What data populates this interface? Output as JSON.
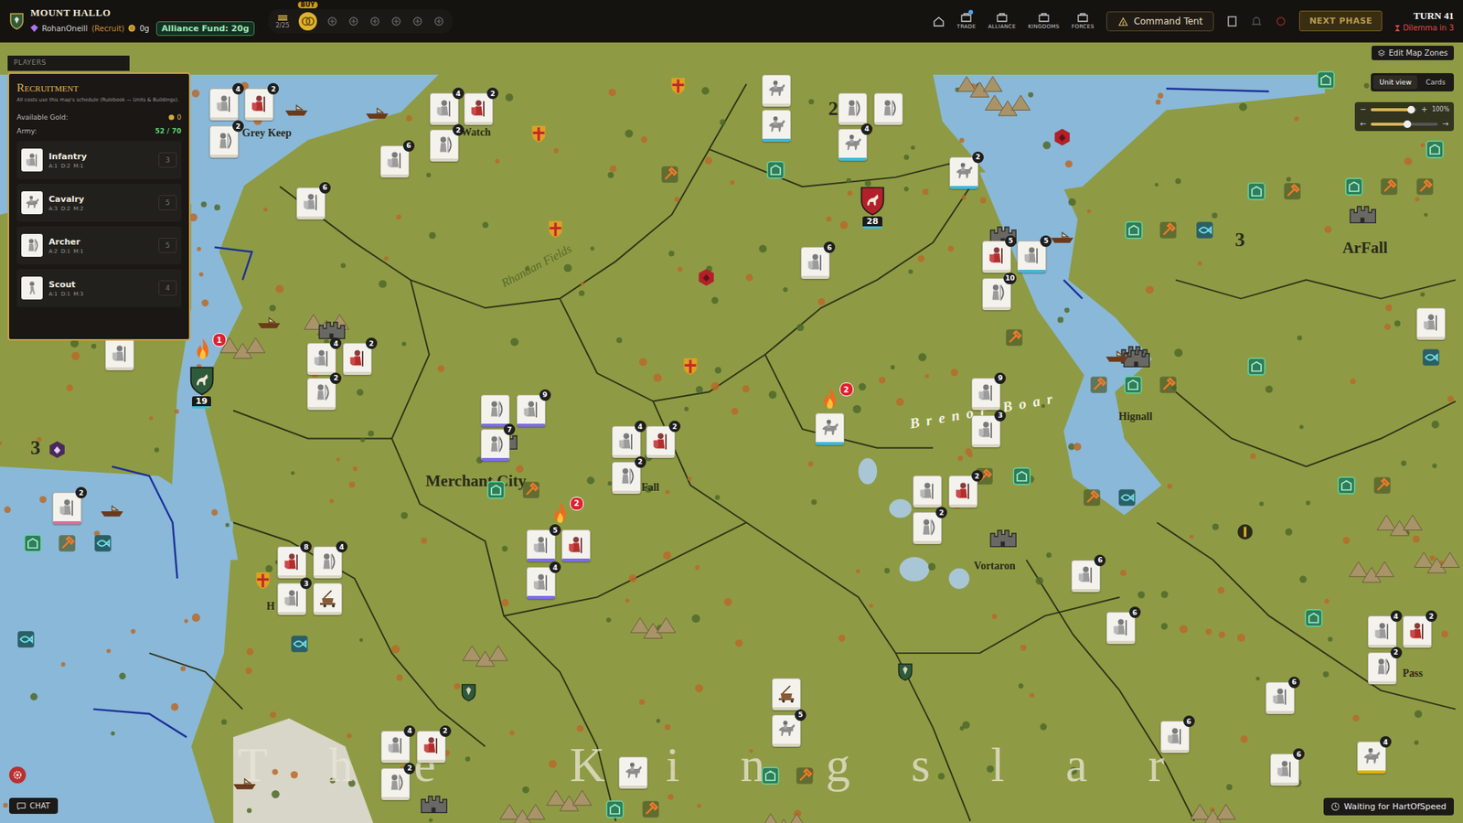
{
  "topbar": {
    "realm": "MOUNT HALLO",
    "player": "RohanOneill",
    "rank": "(Recruit)",
    "gold": "0g",
    "alliance_fund": "Alliance Fund: 20g",
    "supply": "2/25",
    "buy": "BUY",
    "nav": [
      {
        "label": "TRADE",
        "badge": true
      },
      {
        "label": "ALLIANCE",
        "badge": false
      },
      {
        "label": "KINGDOMS",
        "badge": false
      },
      {
        "label": "FORCES",
        "badge": false
      }
    ],
    "command_tent": "Command Tent",
    "next_phase": "NEXT PHASE",
    "turn": "TURN 41",
    "dilemma": "Dilemma in 3"
  },
  "edit_zones": "Edit Map Zones",
  "players_tab": "PLAYERS",
  "view_toggle": [
    {
      "label": "Unit view",
      "selected": true
    },
    {
      "label": "Cards",
      "selected": false
    }
  ],
  "zoom": {
    "reading": "100%",
    "level": 0.88,
    "minus": "−",
    "plus": "+"
  },
  "pan": {
    "level": 0.55,
    "left": "←",
    "right": "→"
  },
  "recruitment": {
    "title": "Recruitment",
    "note": "All costs use this map's schedule (Rulebook — Units & Buildings).",
    "gold_label": "Available Gold:",
    "gold": "0",
    "army_label": "Army:",
    "army": "52 / 70",
    "units": [
      {
        "name": "Infantry",
        "stats": "A:1  D:2  M:1",
        "cost": "3",
        "kind": "infantry"
      },
      {
        "name": "Cavalry",
        "stats": "A:3  D:2  M:2",
        "cost": "5",
        "kind": "cavalry"
      },
      {
        "name": "Archer",
        "stats": "A:2  D:1  M:1",
        "cost": "5",
        "kind": "archer"
      },
      {
        "name": "Scout",
        "stats": "A:1  D:1  M:3",
        "cost": "4",
        "kind": "scout"
      }
    ]
  },
  "map": {
    "labels": [
      {
        "text": "Grey Keep",
        "kind": "place"
      },
      {
        "text": "Watch",
        "kind": "place"
      },
      {
        "text": "Rhandan Fields",
        "kind": "field"
      },
      {
        "text": "Merchant City",
        "kind": "city"
      },
      {
        "text": "Fall",
        "kind": "place"
      },
      {
        "text": "Brenor Boar",
        "kind": "water"
      },
      {
        "text": "Hignall",
        "kind": "place"
      },
      {
        "text": "ArFall",
        "kind": "city"
      },
      {
        "text": "Vortaron",
        "kind": "place"
      },
      {
        "text": "Pass",
        "kind": "place"
      },
      {
        "text": "H",
        "kind": "place"
      },
      {
        "text": "The Kingslar",
        "kind": "land"
      }
    ],
    "region_numbers": [
      "2",
      "3",
      "3"
    ],
    "armies": [
      {
        "count": "19",
        "color": "#2f5a3a"
      },
      {
        "count": "28",
        "color": "#b3202a"
      }
    ],
    "battles": [
      {
        "count": "1"
      },
      {
        "count": "2"
      },
      {
        "count": "2"
      }
    ],
    "units": [
      {
        "kind": "infantry",
        "count": "4",
        "color": "#d9d4c4"
      },
      {
        "kind": "elite",
        "count": "2",
        "color": "#d9d4c4"
      },
      {
        "kind": "archer",
        "count": "2",
        "color": "#d9d4c4"
      },
      {
        "kind": "infantry",
        "count": "4",
        "color": "#d9d4c4"
      },
      {
        "kind": "elite",
        "count": "2",
        "color": "#d9d4c4"
      },
      {
        "kind": "archer",
        "count": "2",
        "color": "#d9d4c4"
      },
      {
        "kind": "infantry",
        "count": "6",
        "color": "#d9d4c4"
      },
      {
        "kind": "infantry",
        "count": "6",
        "color": "#d9d4c4"
      },
      {
        "kind": "cavalry",
        "color": "#d9d4c4"
      },
      {
        "kind": "cavalry",
        "color": "#3fb8d8"
      },
      {
        "kind": "archer",
        "color": "#d9d4c4"
      },
      {
        "kind": "archer",
        "color": "#d9d4c4"
      },
      {
        "kind": "cavalry",
        "count": "4",
        "color": "#3fb8d8"
      },
      {
        "kind": "cavalry",
        "count": "2",
        "color": "#3fb8d8"
      },
      {
        "kind": "infantry",
        "count": "6",
        "color": "#d9d4c4"
      },
      {
        "kind": "elite",
        "count": "5",
        "color": "#d9d4c4"
      },
      {
        "kind": "infantry",
        "count": "5",
        "color": "#3fb8d8"
      },
      {
        "kind": "archer",
        "count": "10",
        "color": "#d9d4c4"
      },
      {
        "kind": "infantry",
        "count": "4",
        "color": "#d9d4c4"
      },
      {
        "kind": "elite",
        "count": "2",
        "color": "#d9d4c4"
      },
      {
        "kind": "archer",
        "count": "2",
        "color": "#d9d4c4"
      },
      {
        "kind": "infantry",
        "color": "#d9d4c4"
      },
      {
        "kind": "archer",
        "color": "#7a6ee6"
      },
      {
        "kind": "infantry",
        "count": "9",
        "color": "#7a6ee6"
      },
      {
        "kind": "archer",
        "count": "7",
        "color": "#7a6ee6"
      },
      {
        "kind": "infantry",
        "count": "4",
        "color": "#d9d4c4"
      },
      {
        "kind": "elite",
        "count": "2",
        "color": "#d9d4c4"
      },
      {
        "kind": "archer",
        "count": "2",
        "color": "#d9d4c4"
      },
      {
        "kind": "cavalry",
        "color": "#3fb8d8"
      },
      {
        "kind": "infantry",
        "count": "9",
        "color": "#d9d4c4"
      },
      {
        "kind": "infantry",
        "count": "3",
        "color": "#d9d4c4"
      },
      {
        "kind": "infantry",
        "color": "#d9d4c4"
      },
      {
        "kind": "elite",
        "count": "2",
        "color": "#d9d4c4"
      },
      {
        "kind": "archer",
        "count": "2",
        "color": "#d9d4c4"
      },
      {
        "kind": "infantry",
        "count": "5",
        "color": "#7a6ee6"
      },
      {
        "kind": "elite",
        "color": "#7a6ee6"
      },
      {
        "kind": "infantry",
        "count": "4",
        "color": "#7a6ee6"
      },
      {
        "kind": "elite",
        "count": "8",
        "color": "#d9d4c4"
      },
      {
        "kind": "archer",
        "count": "4",
        "color": "#d9d4c4"
      },
      {
        "kind": "infantry",
        "count": "3",
        "color": "#d9d4c4"
      },
      {
        "kind": "siege",
        "color": "#d9d4c4"
      },
      {
        "kind": "infantry",
        "count": "2",
        "color": "#e26a9a"
      },
      {
        "kind": "infantry",
        "count": "6",
        "color": "#d9d4c4"
      },
      {
        "kind": "infantry",
        "count": "6",
        "color": "#d9d4c4"
      },
      {
        "kind": "infantry",
        "color": "#d9d4c4"
      },
      {
        "kind": "infantry",
        "count": "4",
        "color": "#d9d4c4"
      },
      {
        "kind": "elite",
        "count": "2",
        "color": "#d9d4c4"
      },
      {
        "kind": "archer",
        "count": "2",
        "color": "#d9d4c4"
      },
      {
        "kind": "infantry",
        "count": "6",
        "color": "#d9d4c4"
      },
      {
        "kind": "infantry",
        "count": "6",
        "color": "#d9d4c4"
      },
      {
        "kind": "infantry",
        "count": "6",
        "color": "#d9d4c4"
      },
      {
        "kind": "cavalry",
        "count": "4",
        "color": "#e0b400"
      },
      {
        "kind": "siege",
        "color": "#d9d4c4"
      },
      {
        "kind": "cavalry",
        "count": "5",
        "color": "#d9d4c4"
      },
      {
        "kind": "cavalry",
        "color": "#d9d4c4"
      },
      {
        "kind": "infantry",
        "count": "4",
        "color": "#d9d4c4"
      },
      {
        "kind": "elite",
        "count": "2",
        "color": "#d9d4c4"
      },
      {
        "kind": "archer",
        "count": "2",
        "color": "#d9d4c4"
      }
    ]
  },
  "chat": "CHAT",
  "waiting": "Waiting for HartOfSpeed"
}
